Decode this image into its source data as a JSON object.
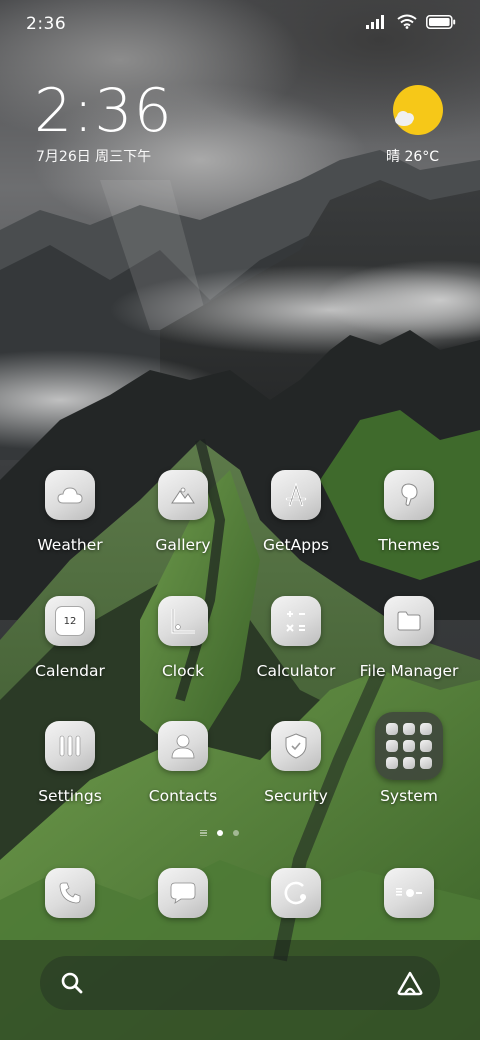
{
  "status_bar": {
    "time": "2:36",
    "icons": [
      "signal-icon",
      "wifi-icon",
      "battery-icon"
    ]
  },
  "clock_widget": {
    "time": "2:36",
    "date": "7月26日 周三下午"
  },
  "weather_widget": {
    "icon": "sun-cloud-icon",
    "text": "晴 26°C",
    "sun_color": "#f6c818"
  },
  "apps": [
    {
      "label": "Weather",
      "icon": "cloud-icon"
    },
    {
      "label": "Gallery",
      "icon": "mountain-image-icon"
    },
    {
      "label": "GetApps",
      "icon": "app-store-icon"
    },
    {
      "label": "Themes",
      "icon": "brush-icon"
    },
    {
      "label": "Calendar",
      "icon": "calendar-icon",
      "day": "12"
    },
    {
      "label": "Clock",
      "icon": "clock-icon"
    },
    {
      "label": "Calculator",
      "icon": "calculator-icon"
    },
    {
      "label": "File Manager",
      "icon": "folder-icon"
    },
    {
      "label": "Settings",
      "icon": "settings-icon"
    },
    {
      "label": "Contacts",
      "icon": "person-icon"
    },
    {
      "label": "Security",
      "icon": "shield-icon"
    },
    {
      "label": "System",
      "icon": "app-folder-icon"
    }
  ],
  "dock": [
    {
      "icon": "phone-icon"
    },
    {
      "icon": "message-icon"
    },
    {
      "icon": "browser-icon"
    },
    {
      "icon": "camera-icon"
    }
  ],
  "page_indicator": {
    "pages": 2,
    "active": 1
  },
  "search": {
    "icon": "search-icon",
    "assistant_icon": "assistant-icon"
  }
}
